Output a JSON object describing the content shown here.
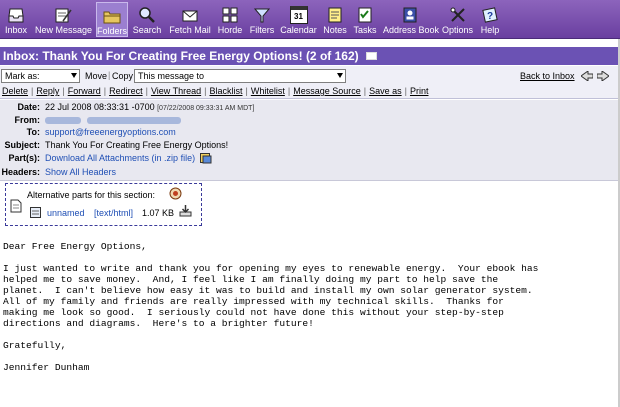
{
  "toolbar": {
    "items": [
      {
        "label": "Inbox",
        "icon": "inbox-icon"
      },
      {
        "label": "New Message",
        "icon": "new-message-icon"
      },
      {
        "label": "Folders",
        "icon": "folders-icon"
      },
      {
        "label": "Search",
        "icon": "search-icon"
      },
      {
        "label": "Fetch Mail",
        "icon": "fetch-mail-icon"
      },
      {
        "label": "Horde",
        "icon": "horde-icon"
      },
      {
        "label": "Filters",
        "icon": "filters-icon"
      },
      {
        "label": "Calendar",
        "icon": "calendar-icon"
      },
      {
        "label": "Notes",
        "icon": "notes-icon"
      },
      {
        "label": "Tasks",
        "icon": "tasks-icon"
      },
      {
        "label": "Address Book",
        "icon": "address-book-icon"
      },
      {
        "label": "Options",
        "icon": "options-icon"
      },
      {
        "label": "Help",
        "icon": "help-icon"
      }
    ],
    "calendar_day": "31"
  },
  "title": {
    "text": "Inbox: Thank You For Creating Free Energy Options!",
    "count": "(2 of 162)"
  },
  "controls": {
    "mark_as": "Mark as:",
    "move": "Move",
    "copy": "Copy",
    "target_folder": "This message to",
    "back_to_inbox": "Back to Inbox"
  },
  "actions": {
    "delete": "Delete",
    "reply": "Reply",
    "forward": "Forward",
    "redirect": "Redirect",
    "view_thread": "View Thread",
    "blacklist": "Blacklist",
    "whitelist": "Whitelist",
    "message_source": "Message Source",
    "save_as": "Save as",
    "print": "Print"
  },
  "headers": {
    "date_label": "Date:",
    "date_value": "22 Jul 2008 08:33:31 -0700",
    "date_local": "[07/22/2008 09:33:31 AM MDT]",
    "from_label": "From:",
    "to_label": "To:",
    "to_value": "support@freeenergyoptions.com",
    "subject_label": "Subject:",
    "subject_value": "Thank You For Creating Free Energy Options!",
    "parts_label": "Part(s):",
    "parts_value": "Download All Attachments (in .zip file)",
    "headers_label": "Headers:",
    "headers_value": "Show All Headers"
  },
  "attachment": {
    "alt_parts_label": "Alternative parts for this section:",
    "name": "unnamed",
    "type": "[text/html]",
    "size": "1.07 KB"
  },
  "body": {
    "text": "Dear Free Energy Options,\n\nI just wanted to write and thank you for opening my eyes to renewable energy.  Your ebook has\nhelped me to save money.  And, I feel like I am finally doing my part to help save the\nplanet.  I can't believe how easy it was to build and install my own solar generator system.\nAll of my family and friends are really impressed with my technical skills.  Thanks for\nmaking me look so good.  I seriously could not have done this without your step-by-step\ndirections and diagrams.  Here's to a brighter future!\n\nGratefully,\n\nJennifer Dunham"
  },
  "colors": {
    "toolbar": "#7b52b0",
    "titlebar": "#6b52b4",
    "link": "#1f4fb5",
    "header_bg": "#e8e8f0"
  }
}
